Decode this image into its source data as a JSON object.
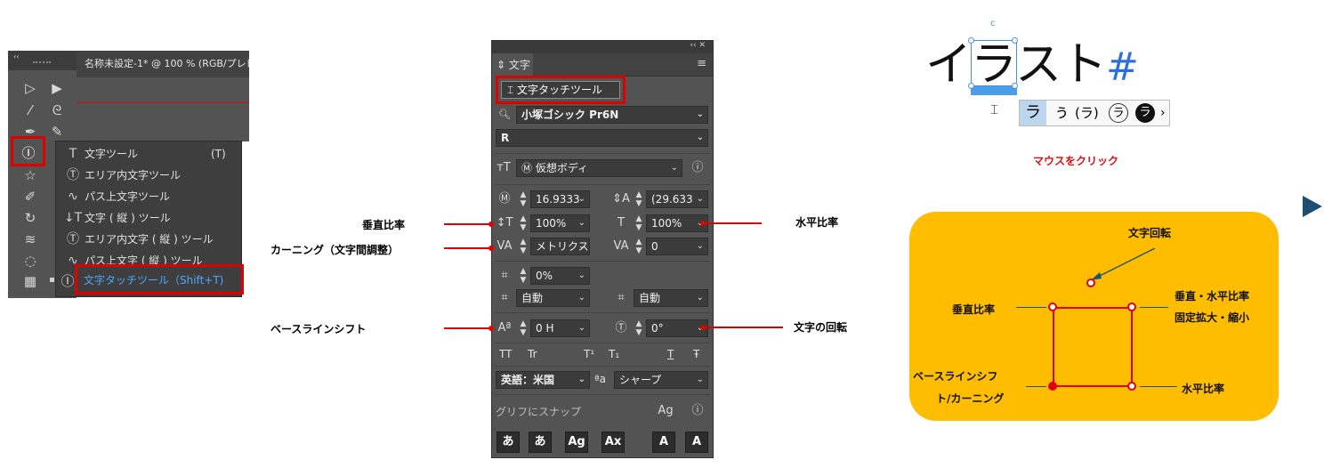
{
  "toolbar": {
    "collapse_glyph": "‹‹",
    "document_tab": "名称未設定-1* @ 100 % (RGB/プレビ",
    "icons": [
      "selection-icon",
      "direct-selection-icon",
      "magic-wand-icon",
      "lasso-icon",
      "pen-icon",
      "curvature-icon",
      "type-touch-icon",
      "star-icon",
      "brush-icon",
      "rotate-icon",
      "warp-icon",
      "blob-icon",
      "grid-icon"
    ]
  },
  "flyout": {
    "items": [
      {
        "label": "文字ツール",
        "key": "(T)",
        "icon": "T"
      },
      {
        "label": "エリア内文字ツール",
        "key": "",
        "icon": "Ⓣ"
      },
      {
        "label": "パス上文字ツール",
        "key": "",
        "icon": "∿"
      },
      {
        "label": "文字 ( 縦 ) ツール",
        "key": "",
        "icon": "↓T"
      },
      {
        "label": "エリア内文字 ( 縦 ) ツール",
        "key": "",
        "icon": "Ⓣ"
      },
      {
        "label": "パス上文字 ( 縦 ) ツール",
        "key": "",
        "icon": "∿"
      }
    ],
    "active_item": "文字タッチツール（Shift+T)"
  },
  "panel": {
    "header_controls": "‹‹  ✕",
    "tab": "文字",
    "touch_tool_button": "文字タッチツール",
    "font_family": "小塚ゴシック Pr6N",
    "font_style": "R",
    "glyph_body": "仮想ボディ",
    "font_size": "16.9333",
    "leading": "(29.633",
    "vertical_scale": "100%",
    "horizontal_scale": "100%",
    "kerning": "メトリクス",
    "tracking": "0",
    "tsume": "0%",
    "aki_left": "自動",
    "aki_right": "自動",
    "baseline_shift": "0 H",
    "rotation": "0°",
    "style_buttons": [
      "TT",
      "Tr",
      "T¹",
      "T₁",
      "T",
      "Ŧ"
    ],
    "language": "英語：米国",
    "aa_label": "ªa",
    "anti_alias": "シャープ",
    "snap_label": "グリフにスナップ",
    "snap_buttons": [
      "あ",
      "あ",
      "Ag",
      "Ax",
      "A",
      "A"
    ]
  },
  "annotations": {
    "vertical_scale": "垂直比率",
    "kerning": "カーニング（文字間調整）",
    "baseline_shift": "ベースラインシフト",
    "horizontal_scale": "水平比率",
    "rotation": "文字の回転"
  },
  "demo": {
    "text_main": "イラスト",
    "text_hash": "#",
    "rotate_handle": "c",
    "candidates": [
      "ラ",
      "ぅ",
      "(ラ)",
      "ラ",
      "ラ",
      "›"
    ],
    "click_label": "マウスをクリック",
    "diagram": {
      "rotation": "文字回転",
      "vertical": "垂直比率",
      "uniform_line1": "垂直・水平比率",
      "uniform_line2": "固定拡大・縮小",
      "baseline_line1": "ベースラインシフ",
      "baseline_line2": "ト/カーニング",
      "horizontal": "水平比率"
    }
  },
  "colors": {
    "accent_red": "#e00000",
    "panel_bg": "#535353",
    "yellow": "#ffbd00",
    "play": "#1d4f73"
  }
}
